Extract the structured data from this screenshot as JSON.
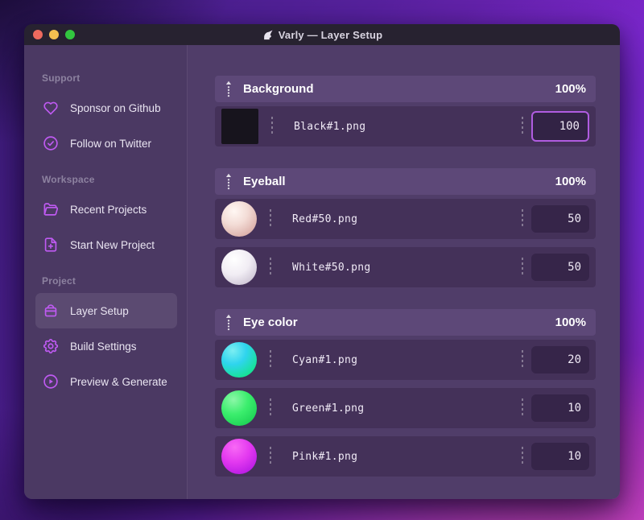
{
  "window": {
    "title": "Varly — Layer Setup",
    "app_icon": "unicorn-icon",
    "traffic_lights": [
      "close-button",
      "minimize-button",
      "zoom-button"
    ]
  },
  "sidebar": {
    "sections": [
      {
        "label": "Support",
        "items": [
          {
            "icon": "heart-icon",
            "label": "Sponsor on Github"
          },
          {
            "icon": "badge-check-icon",
            "label": "Follow on Twitter"
          }
        ]
      },
      {
        "label": "Workspace",
        "items": [
          {
            "icon": "folder-icon",
            "label": "Recent Projects"
          },
          {
            "icon": "file-plus-icon",
            "label": "Start New Project"
          }
        ]
      },
      {
        "label": "Project",
        "items": [
          {
            "icon": "layers-icon",
            "label": "Layer Setup",
            "selected": true
          },
          {
            "icon": "gear-icon",
            "label": "Build Settings"
          },
          {
            "icon": "play-circle-icon",
            "label": "Preview & Generate"
          }
        ]
      }
    ]
  },
  "main": {
    "groups": [
      {
        "name": "Background",
        "weight": "100%",
        "layers": [
          {
            "file": "Black#1.png",
            "value": "100",
            "thumb": "black-square",
            "focused": true
          }
        ]
      },
      {
        "name": "Eyeball",
        "weight": "100%",
        "layers": [
          {
            "file": "Red#50.png",
            "value": "50",
            "thumb": "red-sphere"
          },
          {
            "file": "White#50.png",
            "value": "50",
            "thumb": "white-sphere"
          }
        ]
      },
      {
        "name": "Eye color",
        "weight": "100%",
        "layers": [
          {
            "file": "Cyan#1.png",
            "value": "20",
            "thumb": "cyan-sphere"
          },
          {
            "file": "Green#1.png",
            "value": "10",
            "thumb": "green-sphere"
          },
          {
            "file": "Pink#1.png",
            "value": "10",
            "thumb": "pink-sphere"
          }
        ]
      }
    ]
  },
  "colors": {
    "accent": "#bf5af2",
    "focus_border": "#b05ce0",
    "titlebar_bg": "#272230",
    "sidebar_bg": "#4b3963",
    "main_bg": "#503d69",
    "group_header_bg": "#5d4878",
    "row_bg": "#443159",
    "traffic_red": "#ed6a5e",
    "traffic_yellow": "#f4bf50",
    "traffic_green": "#32c63f"
  }
}
